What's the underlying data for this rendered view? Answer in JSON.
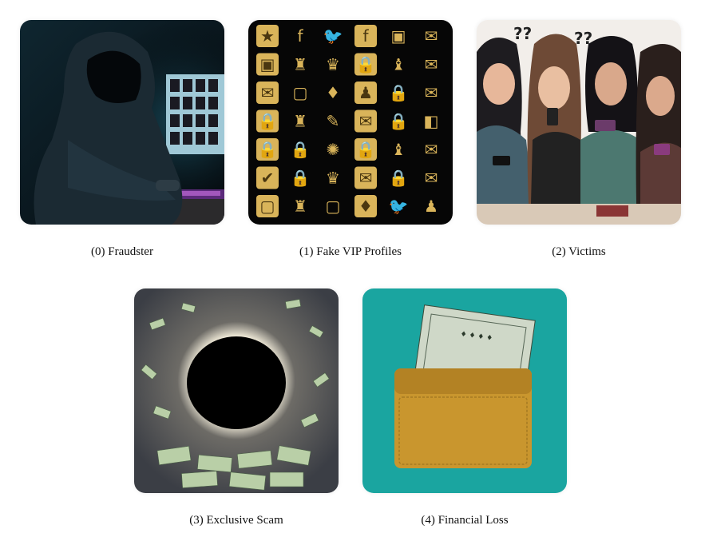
{
  "panels": [
    {
      "caption": "(0) Fraudster",
      "icon": "hooded-hacker"
    },
    {
      "caption": "(1) Fake VIP Profiles",
      "icon": "gold-icon-grid"
    },
    {
      "caption": "(2) Victims",
      "icon": "distressed-women-phones"
    },
    {
      "caption": "(3) Exclusive Scam",
      "icon": "money-vortex"
    },
    {
      "caption": "(4) Financial Loss",
      "icon": "wallet-with-dollar"
    }
  ],
  "colors": {
    "gold": "#d9b45a",
    "teal": "#1aa5a0",
    "wallet": "#c9962e",
    "bill": "#cfd8c8"
  }
}
